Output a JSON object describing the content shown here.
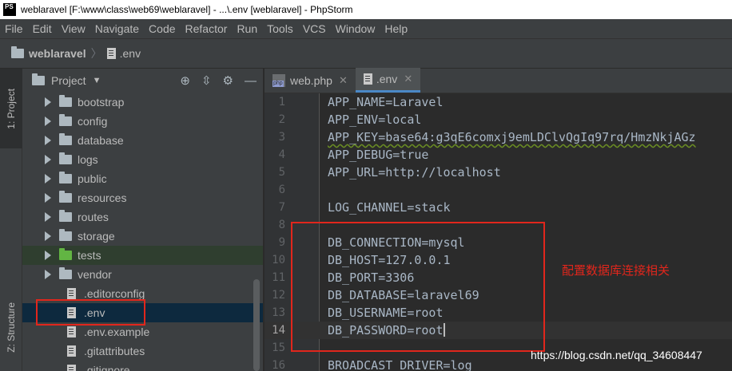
{
  "window": {
    "logo_text": "PS",
    "title": "weblaravel [F:\\www\\class\\web69\\weblaravel] - ...\\.env [weblaravel] - PhpStorm"
  },
  "menu": [
    "File",
    "Edit",
    "View",
    "Navigate",
    "Code",
    "Refactor",
    "Run",
    "Tools",
    "VCS",
    "Window",
    "Help"
  ],
  "breadcrumb": {
    "project": "weblaravel",
    "file": ".env"
  },
  "toolstrip": {
    "project_tab": "1: Project",
    "structure_tab": "Z: Structure"
  },
  "project_panel": {
    "title": "Project",
    "folders": [
      {
        "name": "bootstrap"
      },
      {
        "name": "config"
      },
      {
        "name": "database"
      },
      {
        "name": "logs"
      },
      {
        "name": "public"
      },
      {
        "name": "resources"
      },
      {
        "name": "routes"
      },
      {
        "name": "storage"
      },
      {
        "name": "tests"
      },
      {
        "name": "vendor"
      }
    ],
    "files": [
      ".editorconfig",
      ".env",
      ".env.example",
      ".gitattributes",
      ".gitignore"
    ]
  },
  "editor": {
    "tabs": [
      {
        "label": "web.php",
        "active": false
      },
      {
        "label": ".env",
        "active": true
      }
    ],
    "lines": [
      {
        "n": "1",
        "text": "APP_NAME=Laravel"
      },
      {
        "n": "2",
        "text": "APP_ENV=local"
      },
      {
        "n": "3",
        "text": "APP_KEY=base64:g3qE6comxj9emLDClvQgIq97rq/HmzNkjAGz"
      },
      {
        "n": "4",
        "text": "APP_DEBUG=true"
      },
      {
        "n": "5",
        "text": "APP_URL=http://localhost"
      },
      {
        "n": "6",
        "text": ""
      },
      {
        "n": "7",
        "text": "LOG_CHANNEL=stack"
      },
      {
        "n": "8",
        "text": ""
      },
      {
        "n": "9",
        "text": "DB_CONNECTION=mysql"
      },
      {
        "n": "10",
        "text": "DB_HOST=127.0.0.1"
      },
      {
        "n": "11",
        "text": "DB_PORT=3306"
      },
      {
        "n": "12",
        "text": "DB_DATABASE=laravel69"
      },
      {
        "n": "13",
        "text": "DB_USERNAME=root"
      },
      {
        "n": "14",
        "text": "DB_PASSWORD=root"
      },
      {
        "n": "15",
        "text": ""
      },
      {
        "n": "16",
        "text": "BROADCAST_DRIVER=log"
      }
    ]
  },
  "annotation": "配置数据库连接相关",
  "watermark": "https://blog.csdn.net/qq_34608447",
  "colors": {
    "annotation_red": "#e1261c",
    "folder_green": "#62b543",
    "editor_bg": "#2b2b2b"
  }
}
